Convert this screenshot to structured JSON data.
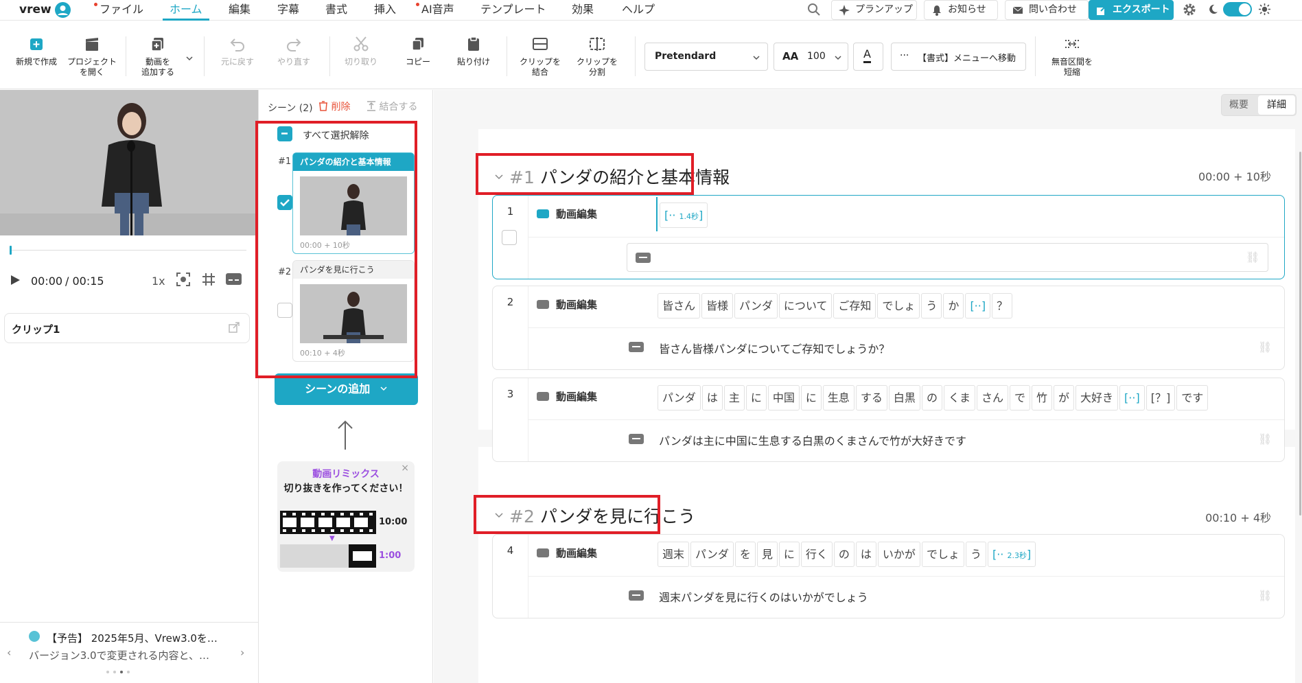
{
  "menu": {
    "logo": "vrew",
    "items": [
      "ファイル",
      "ホーム",
      "編集",
      "字幕",
      "書式",
      "挿入",
      "AI音声",
      "テンプレート",
      "効果",
      "ヘルプ"
    ],
    "planup": "プランアップ",
    "notice": "お知らせ",
    "contact": "問い合わせ",
    "export": "エクスポート"
  },
  "toolbar": {
    "new": "新規で作成",
    "open": [
      "プロジェクト",
      "を開く"
    ],
    "add_video": [
      "動画を",
      "追加する"
    ],
    "undo": "元に戻す",
    "redo": "やり直す",
    "cut": "切り取り",
    "copy": "コピー",
    "paste": "貼り付け",
    "merge_clip": [
      "クリップを",
      "結合"
    ],
    "split_clip": [
      "クリップを",
      "分割"
    ],
    "font": "Pretendard",
    "font_size": "100",
    "format_menu": "【書式】メニューへ移動",
    "shorten_silence": [
      "無音区間を",
      "短縮"
    ]
  },
  "player": {
    "current": "00:00",
    "total": "/ 00:15",
    "speed": "1x",
    "clip_name": "クリップ1"
  },
  "notice_panel": {
    "title": "【予告】 2025年5月、Vrew3.0を…",
    "body": "バージョン3.0で変更される内容と、…"
  },
  "scenes": {
    "header": "シーン (2)",
    "delete": "削除",
    "merge": "結合する",
    "select_all": "すべて選択解除",
    "add_scene": "シーンの追加",
    "items": [
      {
        "num": "#1",
        "title": "パンダの紹介と基本情報",
        "time": "00:00 + 10秒",
        "checked": true
      },
      {
        "num": "#2",
        "title": "パンダを見に行こう",
        "time": "00:10 + 4秒",
        "checked": false
      }
    ]
  },
  "promo": {
    "title": "動画リミックス",
    "subtitle": "切り抜きを作ってください！",
    "long": "10:00",
    "short": "1:00"
  },
  "view_toggle": {
    "summary": "概要",
    "detail": "詳細"
  },
  "main": {
    "clip_label": "動画編集",
    "scene1": {
      "num": "#1",
      "title": "パンダの紹介と基本情報",
      "time": "00:00 + 10秒"
    },
    "scene2": {
      "num": "#2",
      "title": "パンダを見に行こう",
      "time": "00:10 + 4秒"
    },
    "clips": [
      {
        "num": "1",
        "words": [
          {
            "t": "[··",
            "s": "1.4秒",
            "sil": true
          }
        ],
        "subtitle": ""
      },
      {
        "num": "2",
        "words": [
          {
            "t": "皆さん"
          },
          {
            "t": "皆様"
          },
          {
            "t": "パンダ"
          },
          {
            "t": "について"
          },
          {
            "t": "ご存知"
          },
          {
            "t": "でしょ"
          },
          {
            "t": "う"
          },
          {
            "t": "か"
          },
          {
            "t": "[··]",
            "sil": true
          },
          {
            "t": "？"
          }
        ],
        "subtitle": "皆さん皆様パンダについてご存知でしょうか？"
      },
      {
        "num": "3",
        "words": [
          {
            "t": "パンダ"
          },
          {
            "t": "は"
          },
          {
            "t": "主"
          },
          {
            "t": "に"
          },
          {
            "t": "中国"
          },
          {
            "t": "に"
          },
          {
            "t": "生息"
          },
          {
            "t": "する"
          },
          {
            "t": "白黒"
          },
          {
            "t": "の"
          },
          {
            "t": "くま"
          },
          {
            "t": "さん"
          },
          {
            "t": "で"
          },
          {
            "t": "竹"
          },
          {
            "t": "が"
          },
          {
            "t": "大好き"
          },
          {
            "t": "[··]",
            "sil": true
          },
          {
            "t": "[？]"
          },
          {
            "t": "です"
          }
        ],
        "subtitle": "パンダは主に中国に生息する白黒のくまさんで竹が大好きです"
      },
      {
        "num": "4",
        "words": [
          {
            "t": "週末"
          },
          {
            "t": "パンダ"
          },
          {
            "t": "を"
          },
          {
            "t": "見"
          },
          {
            "t": "に"
          },
          {
            "t": "行く"
          },
          {
            "t": "の"
          },
          {
            "t": "は"
          },
          {
            "t": "いかが"
          },
          {
            "t": "でしょ"
          },
          {
            "t": "う"
          },
          {
            "t": "[··",
            "s": "2.3秒",
            "sil": true
          }
        ],
        "subtitle": "週末パンダを見に行くのはいかがでしょう"
      }
    ]
  }
}
